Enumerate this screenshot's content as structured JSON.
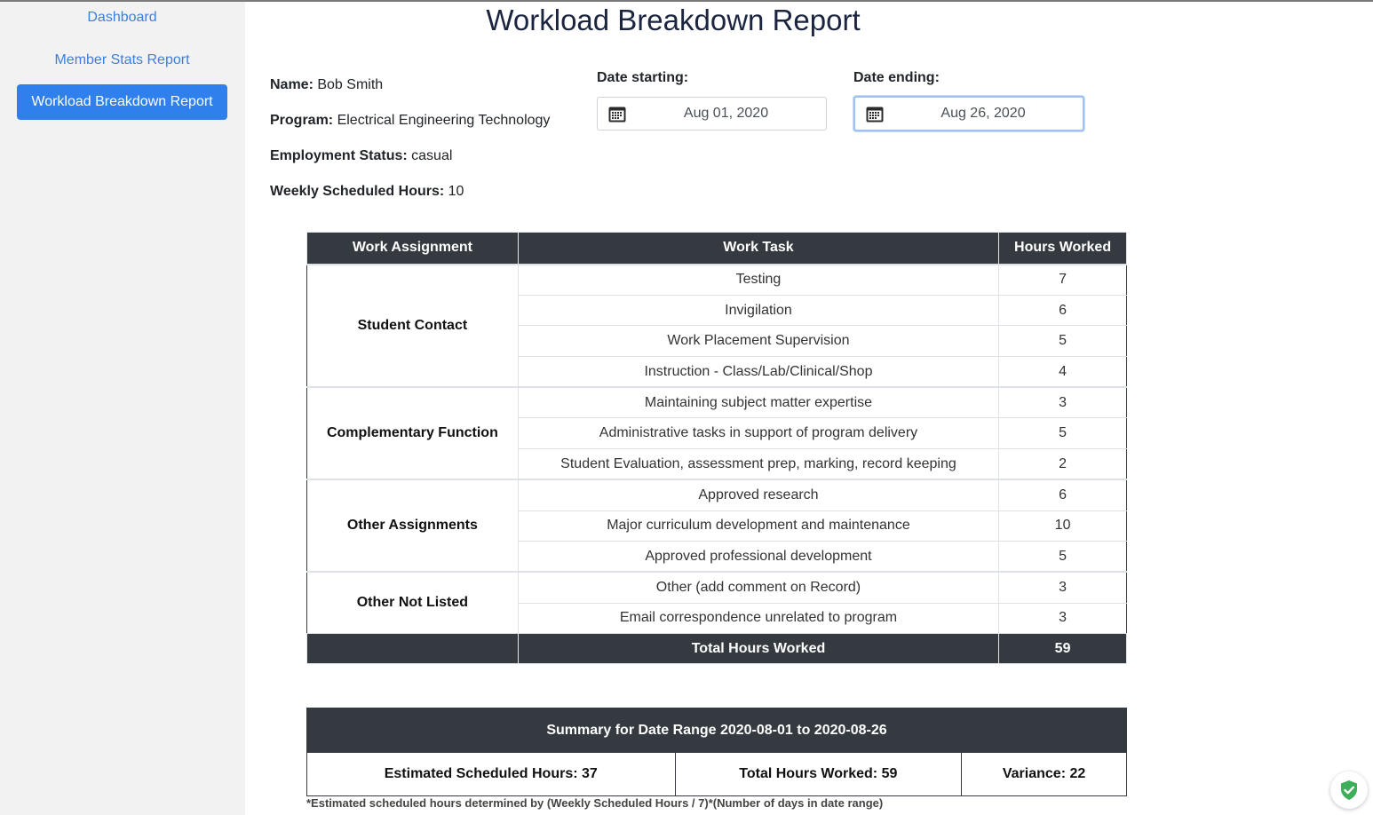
{
  "nav": {
    "items": [
      {
        "label": "Dashboard",
        "active": false
      },
      {
        "label": "Member Stats Report",
        "active": false
      },
      {
        "label": "Workload Breakdown Report",
        "active": true
      }
    ]
  },
  "page_title": "Workload Breakdown Report",
  "member": {
    "name_label": "Name:",
    "name": "Bob Smith",
    "program_label": "Program:",
    "program": "Electrical Engineering Technology",
    "status_label": "Employment Status:",
    "status": "casual",
    "weekly_label": "Weekly Scheduled Hours:",
    "weekly": "10"
  },
  "dates": {
    "start_label": "Date starting:",
    "start_value": "Aug 01, 2020",
    "end_label": "Date ending:",
    "end_value": "Aug 26, 2020"
  },
  "work_table": {
    "headers": [
      "Work Assignment",
      "Work Task",
      "Hours Worked"
    ],
    "groups": [
      {
        "assignment": "Student Contact",
        "tasks": [
          {
            "task": "Testing",
            "hours": "7"
          },
          {
            "task": "Invigilation",
            "hours": "6"
          },
          {
            "task": "Work Placement Supervision",
            "hours": "5"
          },
          {
            "task": "Instruction - Class/Lab/Clinical/Shop",
            "hours": "4"
          }
        ]
      },
      {
        "assignment": "Complementary Function",
        "tasks": [
          {
            "task": "Maintaining subject matter expertise",
            "hours": "3"
          },
          {
            "task": "Administrative tasks in support of program delivery",
            "hours": "5"
          },
          {
            "task": "Student Evaluation, assessment prep, marking, record keeping",
            "hours": "2"
          }
        ]
      },
      {
        "assignment": "Other Assignments",
        "tasks": [
          {
            "task": "Approved research",
            "hours": "6"
          },
          {
            "task": "Major curriculum development and maintenance",
            "hours": "10"
          },
          {
            "task": "Approved professional development",
            "hours": "5"
          }
        ]
      },
      {
        "assignment": "Other Not Listed",
        "tasks": [
          {
            "task": "Other (add comment on Record)",
            "hours": "3"
          },
          {
            "task": "Email correspondence unrelated to program",
            "hours": "3"
          }
        ]
      }
    ],
    "total_label": "Total Hours Worked",
    "total_value": "59"
  },
  "summary": {
    "title": "Summary for Date Range 2020-08-01 to 2020-08-26",
    "estimated": "Estimated Scheduled Hours: 37",
    "total": "Total Hours Worked: 59",
    "variance": "Variance: 22",
    "footnote": "*Estimated scheduled hours determined by (Weekly Scheduled Hours / 7)*(Number of days in date range)"
  },
  "colors": {
    "accent": "#2f80ed",
    "link": "#3d7fe0",
    "table_header": "#343a40",
    "shield": "#3fae5a"
  }
}
